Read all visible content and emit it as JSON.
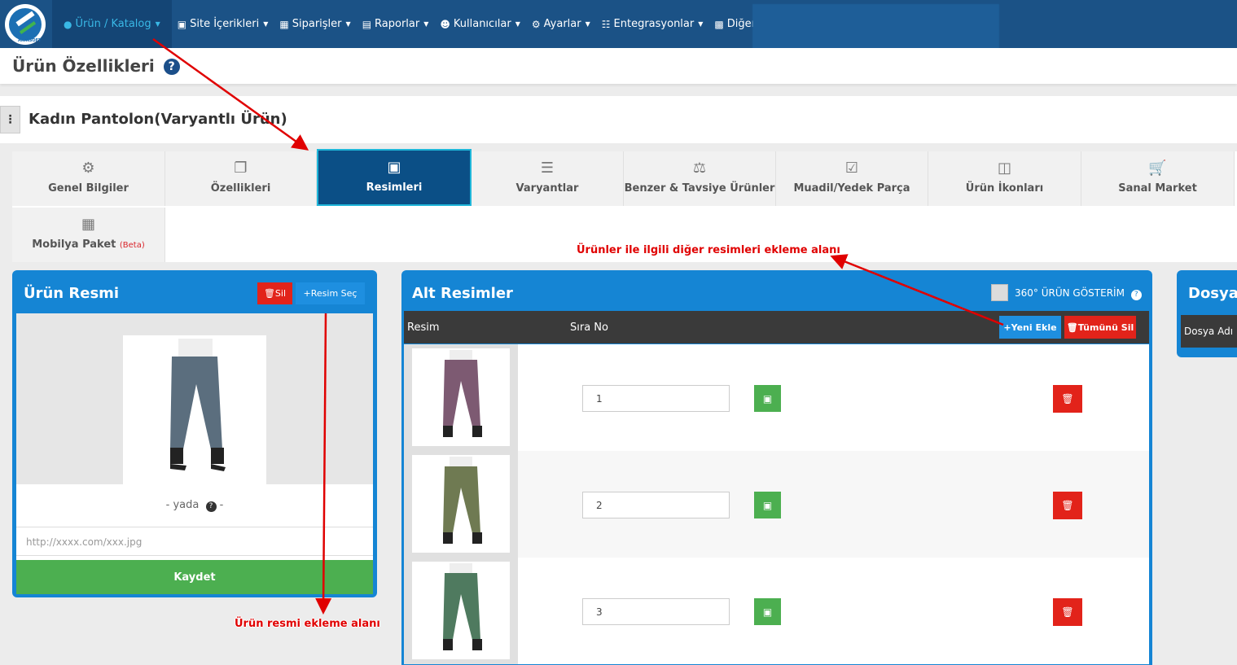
{
  "nav": {
    "logo_text": "AKINSOFT",
    "items": [
      {
        "label": "Ürün / Katalog",
        "icon": "users-icon"
      },
      {
        "label": "Site İçerikleri",
        "icon": "pages-icon"
      },
      {
        "label": "Siparişler",
        "icon": "boxes-icon"
      },
      {
        "label": "Raporlar",
        "icon": "report-icon"
      },
      {
        "label": "Kullanıcılar",
        "icon": "user-group-icon"
      },
      {
        "label": "Ayarlar",
        "icon": "gears-icon"
      },
      {
        "label": "Entegrasyonlar",
        "icon": "sitemap-icon"
      },
      {
        "label": "Diğer",
        "icon": "grid-icon"
      }
    ]
  },
  "header": {
    "title": "Ürün Özellikleri"
  },
  "product": {
    "name": "Kadın Pantolon(Varyantlı Ürün)"
  },
  "tabs": [
    {
      "label": "Genel Bilgiler",
      "icon": "gears-icon"
    },
    {
      "label": "Özellikleri",
      "icon": "copy-icon"
    },
    {
      "label": "Resimleri",
      "icon": "images-icon"
    },
    {
      "label": "Varyantlar",
      "icon": "bars-icon"
    },
    {
      "label": "Benzer & Tavsiye Ürünler",
      "icon": "balance-icon"
    },
    {
      "label": "Muadil/Yedek Parça",
      "icon": "check-square-icon"
    },
    {
      "label": "Ürün İkonları",
      "icon": "file-image-icon"
    },
    {
      "label": "Sanal Market",
      "icon": "cart-icon"
    },
    {
      "label": "Mobilya Paket",
      "icon": "cubes-icon",
      "badge": "(Beta)"
    }
  ],
  "active_tab": "Resimleri",
  "main_image_panel": {
    "title": "Ürün Resmi",
    "delete_label": "Sil",
    "select_label": "Resim Seç",
    "or_label": "- yada",
    "or_suffix": "-",
    "url_placeholder": "http://xxxx.com/xxx.jpg",
    "save_label": "Kaydet"
  },
  "sub_images_panel": {
    "title": "Alt Resimler",
    "toggle_label": "360° ÜRÜN GÖSTERİM",
    "col_image": "Resim",
    "col_order": "Sıra No",
    "add_label": "Yeni Ekle",
    "delete_all_label": "Tümünü Sil",
    "rows": [
      {
        "order": "1",
        "color": "#7d5a72"
      },
      {
        "order": "2",
        "color": "#6f7a52"
      },
      {
        "order": "3",
        "color": "#4f7a5f"
      }
    ]
  },
  "files_panel": {
    "title": "Dosyala",
    "col_name": "Dosya Adı"
  },
  "annotations": {
    "sub_images_note": "Ürünler ile ilgili diğer resimleri ekleme alanı",
    "main_image_note": "Ürün resmi ekleme alanı"
  },
  "colors": {
    "nav": "#1b5286",
    "accent": "#1585d4",
    "danger": "#e2231a",
    "success": "#4caf50"
  }
}
